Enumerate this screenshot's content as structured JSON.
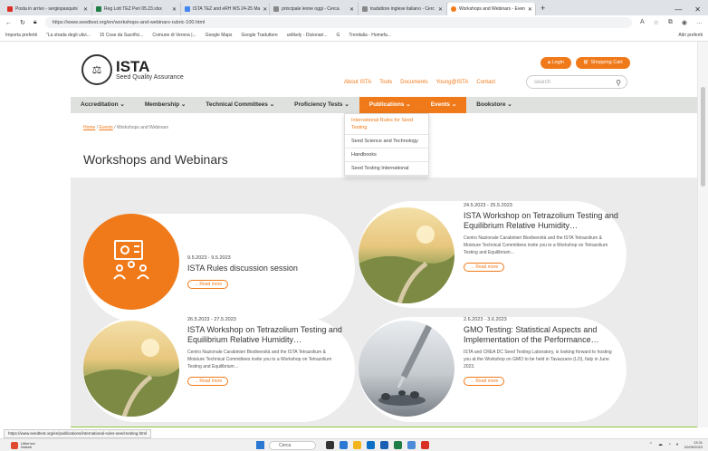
{
  "browser": {
    "tabs": [
      {
        "label": "Posta in arrivo - sergiopasquini",
        "color": "#d93025",
        "active": false
      },
      {
        "label": "Reg Lott TEZ Peri 05.23.xlsx",
        "color": "#1e7e45",
        "active": false
      },
      {
        "label": "ISTA TEZ and eRH WS 24-25 Ma",
        "color": "#4285f4",
        "active": false
      },
      {
        "label": "principale leone oggi - Cerca",
        "color": "#888888",
        "active": false
      },
      {
        "label": "traduttore inglese italiano - Cerc",
        "color": "#888888",
        "active": false
      },
      {
        "label": "Workshops and Webinars - Even",
        "color": "#f07a1a",
        "active": true
      }
    ],
    "new_tab": "+",
    "url": "https://www.seedtest.org/en/workshops-and-webinars-rubric-100.html",
    "bookmarks": [
      "Importa preferiti",
      "\"La strada degli ulivi...",
      "15 Cose da Sacrifici...",
      "Comune di Verona |...",
      "Google Maps",
      "Google Traduttore",
      "unlikely - Dizionari...",
      "G",
      "Trenitalia - Homefa..."
    ],
    "other_bookmarks": "Altri preferiti"
  },
  "header": {
    "logo_name": "ISTA",
    "logo_sub": "Seed Quality Assurance",
    "login": "Login",
    "cart": "Shopping Cart",
    "links": [
      "About ISTA",
      "Tools",
      "Documents",
      "Young@ISTA",
      "Contact"
    ],
    "search_placeholder": "search"
  },
  "nav": {
    "items": [
      "Accreditation",
      "Membership",
      "Technical Committees",
      "Proficiency Tests",
      "Publications",
      "Events",
      "Bookstore"
    ]
  },
  "dropdown": {
    "items": [
      "International Rules for Seed Testing",
      "Seed Science and Technology",
      "Handbooks",
      "Seed Testing International"
    ]
  },
  "breadcrumb": {
    "home": "Home",
    "events": "Events",
    "current": "Workshops and Webinars"
  },
  "page_title": "Workshops and Webinars",
  "cards": [
    {
      "date": "9.5.2023 - 9.5.2023",
      "title": "ISTA Rules discussion session",
      "desc": "",
      "more": "→ Read more"
    },
    {
      "date": "24.5.2023 - 25.5.2023",
      "title": "ISTA Workshop on Tetrazolium Testing and Equilibrium Relative Humidity…",
      "desc": "Centro Nazionale Carabinieri Biodiversità and the ISTA Tetrazolium & Moisture Technical Committees invite you to a Workshop on Tetrazolium Testing and Equilibrium…",
      "more": "→ Read more"
    },
    {
      "date": "26.5.2023 - 27.5.2023",
      "title": "ISTA Workshop on Tetrazolium Testing and Equilibrium Relative Humidity…",
      "desc": "Centro Nazionale Carabinieri Biodiversità and the ISTA Tetrazolium & Moisture Technical Committees invite you to a Workshop on Tetrazolium Testing and Equilibrium…",
      "more": "→ Read more"
    },
    {
      "date": "2.6.2023 - 3.6.2023",
      "title": "GMO Testing: Statistical Aspects and Implementation of the Performance…",
      "desc": "ISTA and CREA DC Seed Testing Laboratory, is looking forward to hosting you at the Workshop on GMO to be held in Tavazzano (LO), Italy in June 2023.",
      "more": "→ Read more"
    }
  ],
  "status_url": "https://www.seedtest.org/en/publications/international-rules-seed-testing.html",
  "taskbar": {
    "weather_line1": "Ultim'ora",
    "weather_line2": "Notizie",
    "search": "Cerca",
    "time": "13:31",
    "date": "02/05/2023"
  },
  "colors": {
    "accent": "#f07a1a",
    "nav_bg": "#dfe1de",
    "green": "#8cc63f"
  }
}
